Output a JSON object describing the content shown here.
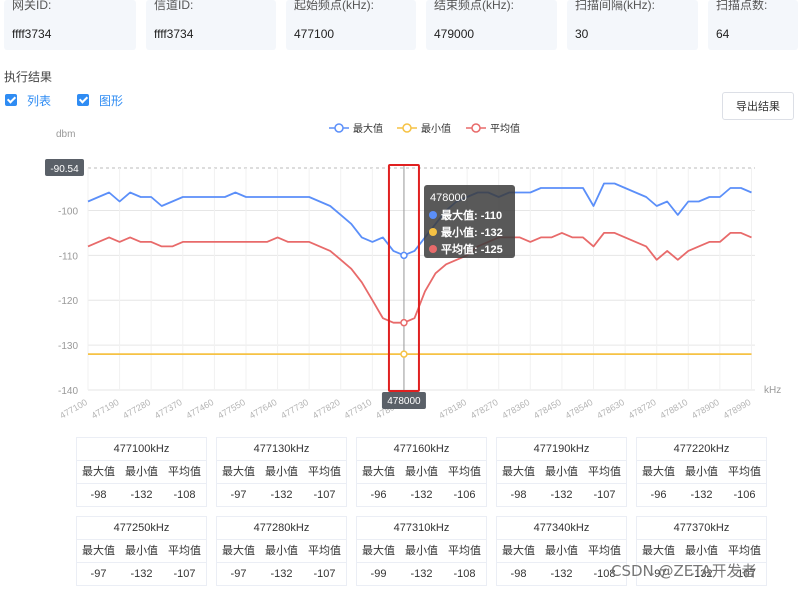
{
  "info": [
    {
      "label": "网关ID:",
      "value": "ffff3734"
    },
    {
      "label": "信道ID:",
      "value": "ffff3734"
    },
    {
      "label": "起始频点(kHz):",
      "value": "477100"
    },
    {
      "label": "结束频点(kHz):",
      "value": "479000"
    },
    {
      "label": "扫描间隔(kHz):",
      "value": "30"
    },
    {
      "label": "扫描点数:",
      "value": "64"
    }
  ],
  "section_title": "执行结果",
  "checkboxes": [
    {
      "label": "列表",
      "checked": true
    },
    {
      "label": "图形",
      "checked": true
    }
  ],
  "export_label": "导出结果",
  "colors": {
    "max": "#5b8ff9",
    "min": "#f6c244",
    "avg": "#e86a6a",
    "checkbox": "#2f8cf3",
    "highlight": "#e02020"
  },
  "chart_data": {
    "type": "line",
    "ylabel": "dbm",
    "xunit": "kHz",
    "ylim": [
      -140,
      -90.54
    ],
    "yticks": [
      -100,
      -110,
      -120,
      -130,
      -140
    ],
    "ymax_label": "-90.54",
    "xticks": [
      "477100",
      "477190",
      "477280",
      "477370",
      "477460",
      "477550",
      "477640",
      "477730",
      "477820",
      "477910",
      "478000",
      "478180",
      "478270",
      "478360",
      "478450",
      "478540",
      "478630",
      "478720",
      "478810",
      "478900",
      "478990"
    ],
    "xstart": 477100,
    "xend": 479000,
    "legend": [
      "最大值",
      "最小值",
      "平均值"
    ],
    "series": [
      {
        "name": "最大值",
        "points": [
          [
            477100,
            -98
          ],
          [
            477130,
            -97
          ],
          [
            477160,
            -96
          ],
          [
            477190,
            -98
          ],
          [
            477220,
            -96
          ],
          [
            477250,
            -97
          ],
          [
            477280,
            -97
          ],
          [
            477310,
            -99
          ],
          [
            477340,
            -98
          ],
          [
            477370,
            -97
          ],
          [
            477400,
            -97
          ],
          [
            477430,
            -97
          ],
          [
            477460,
            -97
          ],
          [
            477490,
            -97
          ],
          [
            477520,
            -96
          ],
          [
            477550,
            -97
          ],
          [
            477580,
            -97
          ],
          [
            477610,
            -97
          ],
          [
            477640,
            -97
          ],
          [
            477670,
            -97
          ],
          [
            477700,
            -97
          ],
          [
            477730,
            -97
          ],
          [
            477760,
            -98
          ],
          [
            477790,
            -99
          ],
          [
            477820,
            -101
          ],
          [
            477850,
            -103
          ],
          [
            477880,
            -106
          ],
          [
            477910,
            -107
          ],
          [
            477940,
            -106
          ],
          [
            477970,
            -109
          ],
          [
            478000,
            -110
          ],
          [
            478030,
            -109
          ],
          [
            478060,
            -106
          ],
          [
            478090,
            -103
          ],
          [
            478120,
            -100
          ],
          [
            478150,
            -98
          ],
          [
            478180,
            -97
          ],
          [
            478210,
            -96
          ],
          [
            478240,
            -96
          ],
          [
            478270,
            -97
          ],
          [
            478300,
            -96
          ],
          [
            478330,
            -96
          ],
          [
            478360,
            -96
          ],
          [
            478390,
            -95
          ],
          [
            478420,
            -95
          ],
          [
            478450,
            -95
          ],
          [
            478480,
            -95
          ],
          [
            478510,
            -95
          ],
          [
            478540,
            -99
          ],
          [
            478570,
            -94
          ],
          [
            478600,
            -94
          ],
          [
            478630,
            -95
          ],
          [
            478660,
            -96
          ],
          [
            478690,
            -97
          ],
          [
            478720,
            -99
          ],
          [
            478750,
            -98
          ],
          [
            478780,
            -101
          ],
          [
            478810,
            -98
          ],
          [
            478840,
            -98
          ],
          [
            478870,
            -97
          ],
          [
            478900,
            -97
          ],
          [
            478930,
            -95
          ],
          [
            478960,
            -95
          ],
          [
            478990,
            -96
          ]
        ]
      },
      {
        "name": "最小值",
        "points": [
          [
            477100,
            -132
          ],
          [
            478990,
            -132
          ]
        ]
      },
      {
        "name": "平均值",
        "points": [
          [
            477100,
            -108
          ],
          [
            477130,
            -107
          ],
          [
            477160,
            -106
          ],
          [
            477190,
            -107
          ],
          [
            477220,
            -106
          ],
          [
            477250,
            -107
          ],
          [
            477280,
            -107
          ],
          [
            477310,
            -108
          ],
          [
            477340,
            -108
          ],
          [
            477370,
            -107
          ],
          [
            477400,
            -107
          ],
          [
            477430,
            -107
          ],
          [
            477460,
            -107
          ],
          [
            477490,
            -107
          ],
          [
            477520,
            -107
          ],
          [
            477550,
            -107
          ],
          [
            477580,
            -107
          ],
          [
            477610,
            -107
          ],
          [
            477640,
            -106
          ],
          [
            477670,
            -107
          ],
          [
            477700,
            -107
          ],
          [
            477730,
            -107
          ],
          [
            477760,
            -108
          ],
          [
            477790,
            -109
          ],
          [
            477820,
            -111
          ],
          [
            477850,
            -113
          ],
          [
            477880,
            -116
          ],
          [
            477910,
            -120
          ],
          [
            477940,
            -124
          ],
          [
            477970,
            -125
          ],
          [
            478000,
            -125
          ],
          [
            478030,
            -124
          ],
          [
            478060,
            -118
          ],
          [
            478090,
            -114
          ],
          [
            478120,
            -112
          ],
          [
            478150,
            -111
          ],
          [
            478180,
            -110
          ],
          [
            478210,
            -108
          ],
          [
            478240,
            -107
          ],
          [
            478270,
            -106
          ],
          [
            478300,
            -106
          ],
          [
            478330,
            -106
          ],
          [
            478360,
            -107
          ],
          [
            478390,
            -106
          ],
          [
            478420,
            -106
          ],
          [
            478450,
            -105
          ],
          [
            478480,
            -106
          ],
          [
            478510,
            -106
          ],
          [
            478540,
            -108
          ],
          [
            478570,
            -105
          ],
          [
            478600,
            -105
          ],
          [
            478630,
            -106
          ],
          [
            478660,
            -107
          ],
          [
            478690,
            -108
          ],
          [
            478720,
            -111
          ],
          [
            478750,
            -109
          ],
          [
            478780,
            -111
          ],
          [
            478810,
            -109
          ],
          [
            478840,
            -108
          ],
          [
            478870,
            -107
          ],
          [
            478900,
            -107
          ],
          [
            478930,
            -105
          ],
          [
            478960,
            -105
          ],
          [
            478990,
            -106
          ]
        ]
      }
    ],
    "tooltip": {
      "title": "478000",
      "rows": [
        {
          "name": "最大值",
          "value": "-110"
        },
        {
          "name": "最小值",
          "value": "-132"
        },
        {
          "name": "平均值",
          "value": "-125"
        }
      ]
    },
    "highlight_x": 478000,
    "axis_pointer_label": "478000"
  },
  "grid_headers": [
    "最大值",
    "最小值",
    "平均值"
  ],
  "grid": [
    {
      "freq": "477100kHz",
      "max": "-98",
      "min": "-132",
      "avg": "-108"
    },
    {
      "freq": "477130kHz",
      "max": "-97",
      "min": "-132",
      "avg": "-107"
    },
    {
      "freq": "477160kHz",
      "max": "-96",
      "min": "-132",
      "avg": "-106"
    },
    {
      "freq": "477190kHz",
      "max": "-98",
      "min": "-132",
      "avg": "-107"
    },
    {
      "freq": "477220kHz",
      "max": "-96",
      "min": "-132",
      "avg": "-106"
    },
    {
      "freq": "477250kHz",
      "max": "-97",
      "min": "-132",
      "avg": "-107"
    },
    {
      "freq": "477280kHz",
      "max": "-97",
      "min": "-132",
      "avg": "-107"
    },
    {
      "freq": "477310kHz",
      "max": "-99",
      "min": "-132",
      "avg": "-108"
    },
    {
      "freq": "477340kHz",
      "max": "-98",
      "min": "-132",
      "avg": "-108"
    },
    {
      "freq": "477370kHz",
      "max": "-97",
      "min": "-132",
      "avg": "-107"
    }
  ],
  "watermark": "CSDN @ZETA开发者"
}
